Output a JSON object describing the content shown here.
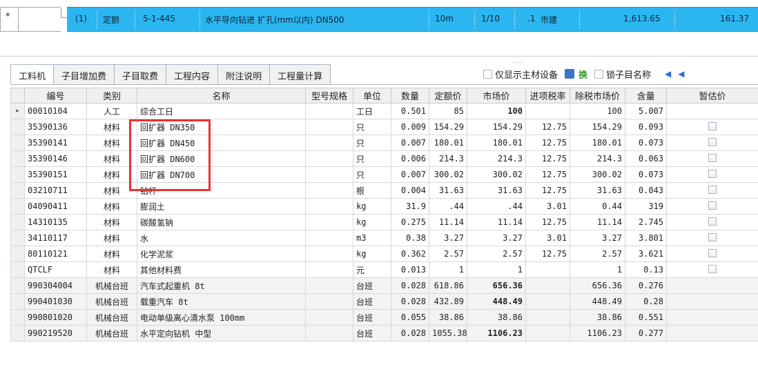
{
  "top_row": {
    "marker": "*",
    "index": "(1)",
    "type": "定额",
    "code": "5-1-445",
    "name": "水平导向钻进 扩孔(mm以内) DN500",
    "unit": "10m",
    "ratio": "1/10",
    "qty": ".1",
    "category": "市建",
    "price": "1,613.65",
    "total": "161.37"
  },
  "tabs": [
    "工料机",
    "子目增加费",
    "子目取费",
    "工程内容",
    "附注说明",
    "工程量计算"
  ],
  "tools": {
    "only_main": "仅显示主材设备",
    "swap": "换",
    "lock_name": "锁子目名称",
    "dots": "....",
    "first_arrow": "◀",
    "prev_arrow": "◀"
  },
  "columns": [
    "编号",
    "类别",
    "名称",
    "型号规格",
    "单位",
    "数量",
    "定额价",
    "市场价",
    "进项税率",
    "除税市场价",
    "含量",
    "暂估价"
  ],
  "rows": [
    {
      "marker": "▸",
      "code": "00010104",
      "cat": "人工",
      "name": "综合工日",
      "spec": "",
      "unit": "工日",
      "qty": "0.501",
      "quota": "85",
      "market": "100",
      "tax": "",
      "net": "100",
      "content": "5.007",
      "cb": false,
      "bold": true,
      "mech": false
    },
    {
      "marker": "",
      "code": "35390136",
      "cat": "材料",
      "name": "回扩器 DN350",
      "spec": "",
      "unit": "只",
      "qty": "0.009",
      "quota": "154.29",
      "market": "154.29",
      "tax": "12.75",
      "net": "154.29",
      "content": "0.093",
      "cb": true,
      "bold": false,
      "mech": false
    },
    {
      "marker": "",
      "code": "35390141",
      "cat": "材料",
      "name": "回扩器 DN450",
      "spec": "",
      "unit": "只",
      "qty": "0.007",
      "quota": "180.01",
      "market": "180.01",
      "tax": "12.75",
      "net": "180.01",
      "content": "0.073",
      "cb": true,
      "bold": false,
      "mech": false
    },
    {
      "marker": "",
      "code": "35390146",
      "cat": "材料",
      "name": "回扩器 DN600",
      "spec": "",
      "unit": "只",
      "qty": "0.006",
      "quota": "214.3",
      "market": "214.3",
      "tax": "12.75",
      "net": "214.3",
      "content": "0.063",
      "cb": true,
      "bold": false,
      "mech": false
    },
    {
      "marker": "",
      "code": "35390151",
      "cat": "材料",
      "name": "回扩器 DN700",
      "spec": "",
      "unit": "只",
      "qty": "0.007",
      "quota": "300.02",
      "market": "300.02",
      "tax": "12.75",
      "net": "300.02",
      "content": "0.073",
      "cb": true,
      "bold": false,
      "mech": false
    },
    {
      "marker": "",
      "code": "03210711",
      "cat": "材料",
      "name": "钻杆",
      "spec": "",
      "unit": "根",
      "qty": "0.004",
      "quota": "31.63",
      "market": "31.63",
      "tax": "12.75",
      "net": "31.63",
      "content": "0.043",
      "cb": true,
      "bold": false,
      "mech": false
    },
    {
      "marker": "",
      "code": "04090411",
      "cat": "材料",
      "name": "膨润土",
      "spec": "",
      "unit": "kg",
      "qty": "31.9",
      "quota": ".44",
      "market": ".44",
      "tax": "3.01",
      "net": "0.44",
      "content": "319",
      "cb": true,
      "bold": false,
      "mech": false
    },
    {
      "marker": "",
      "code": "14310135",
      "cat": "材料",
      "name": "碳酸氢钠",
      "spec": "",
      "unit": "kg",
      "qty": "0.275",
      "quota": "11.14",
      "market": "11.14",
      "tax": "12.75",
      "net": "11.14",
      "content": "2.745",
      "cb": true,
      "bold": false,
      "mech": false
    },
    {
      "marker": "",
      "code": "34110117",
      "cat": "材料",
      "name": "水",
      "spec": "",
      "unit": "m3",
      "qty": "0.38",
      "quota": "3.27",
      "market": "3.27",
      "tax": "3.01",
      "net": "3.27",
      "content": "3.801",
      "cb": true,
      "bold": false,
      "mech": false
    },
    {
      "marker": "",
      "code": "80110121",
      "cat": "材料",
      "name": "化学泥浆",
      "spec": "",
      "unit": "kg",
      "qty": "0.362",
      "quota": "2.57",
      "market": "2.57",
      "tax": "12.75",
      "net": "2.57",
      "content": "3.621",
      "cb": true,
      "bold": false,
      "mech": false
    },
    {
      "marker": "",
      "code": "QTCLF",
      "cat": "材料",
      "name": "其他材料费",
      "spec": "",
      "unit": "元",
      "qty": "0.013",
      "quota": "1",
      "market": "1",
      "tax": "",
      "net": "1",
      "content": "0.13",
      "cb": true,
      "bold": false,
      "mech": false
    },
    {
      "marker": "",
      "code": "990304004",
      "cat": "机械台班",
      "name": "汽车式起重机 8t",
      "spec": "",
      "unit": "台班",
      "qty": "0.028",
      "quota": "618.86",
      "market": "656.36",
      "tax": "",
      "net": "656.36",
      "content": "0.276",
      "cb": false,
      "bold": true,
      "mech": true
    },
    {
      "marker": "",
      "code": "990401030",
      "cat": "机械台班",
      "name": "载重汽车 8t",
      "spec": "",
      "unit": "台班",
      "qty": "0.028",
      "quota": "432.89",
      "market": "448.49",
      "tax": "",
      "net": "448.49",
      "content": "0.28",
      "cb": false,
      "bold": true,
      "mech": true
    },
    {
      "marker": "",
      "code": "990801020",
      "cat": "机械台班",
      "name": "电动单级离心清水泵 100mm",
      "spec": "",
      "unit": "台班",
      "qty": "0.055",
      "quota": "38.86",
      "market": "38.86",
      "tax": "",
      "net": "38.86",
      "content": "0.551",
      "cb": false,
      "bold": false,
      "mech": true
    },
    {
      "marker": "",
      "code": "990219520",
      "cat": "机械台班",
      "name": "水平定向钻机 中型",
      "spec": "",
      "unit": "台班",
      "qty": "0.028",
      "quota": "1055.38",
      "market": "1106.23",
      "tax": "",
      "net": "1106.23",
      "content": "0.277",
      "cb": false,
      "bold": true,
      "mech": true
    }
  ]
}
